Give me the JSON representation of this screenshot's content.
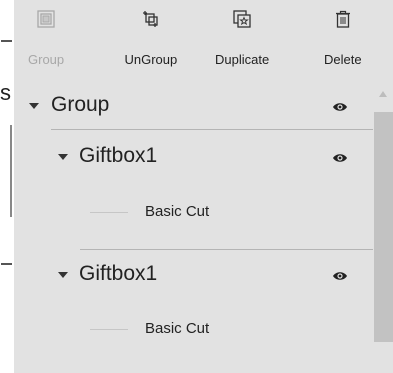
{
  "edge": {
    "letter_s": "s"
  },
  "toolbar": {
    "group_label": "Group",
    "ungroup_label": "UnGroup",
    "duplicate_label": "Duplicate",
    "delete_label": "Delete",
    "icons": [
      "group-icon",
      "ungroup-icon",
      "duplicate-icon",
      "delete-icon"
    ],
    "group_disabled": true
  },
  "layers": {
    "group": {
      "label": "Group",
      "expanded": true,
      "visible": true
    },
    "children": [
      {
        "label": "Giftbox1",
        "expanded": true,
        "visible": true,
        "cut_label": "Basic Cut"
      },
      {
        "label": "Giftbox1",
        "expanded": true,
        "visible": true,
        "cut_label": "Basic Cut"
      }
    ]
  },
  "colors": {
    "panel_bg": "#e2e2e2",
    "disabled_text": "#a8a8a8",
    "text": "#222222",
    "scroll_thumb": "#c2c2c2"
  }
}
